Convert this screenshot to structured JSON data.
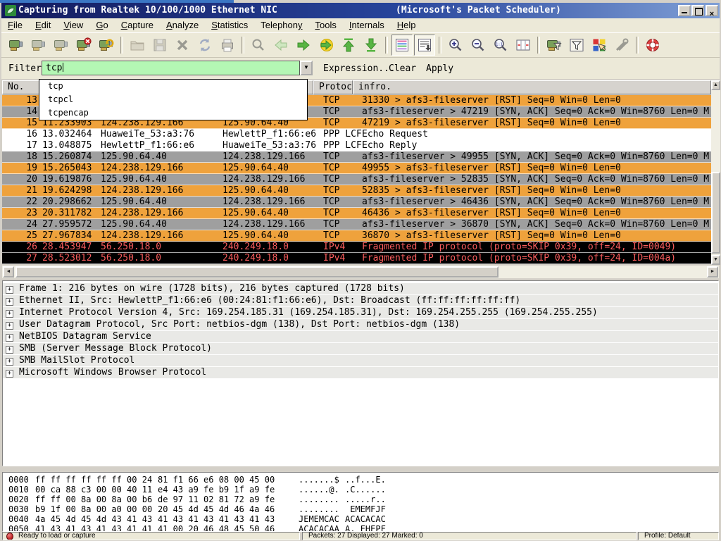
{
  "window": {
    "title_left": "Capturing from Realtek 10/100/1000 Ethernet NIC",
    "title_right": "(Microsoft's Packet Scheduler)"
  },
  "menu": {
    "items": [
      {
        "label": "File",
        "u": 0
      },
      {
        "label": "Edit",
        "u": 0
      },
      {
        "label": "View",
        "u": 0
      },
      {
        "label": "Go",
        "u": 0
      },
      {
        "label": "Capture",
        "u": 0
      },
      {
        "label": "Analyze",
        "u": 0
      },
      {
        "label": "Statistics",
        "u": 0
      },
      {
        "label": "Telephony",
        "u": 8
      },
      {
        "label": "Tools",
        "u": 0
      },
      {
        "label": "Internals",
        "u": 0
      },
      {
        "label": "Help",
        "u": 0
      }
    ]
  },
  "toolbar": {
    "buttons": [
      {
        "icon": "interfaces-icon"
      },
      {
        "icon": "capture-options-icon"
      },
      {
        "icon": "capture-start-icon"
      },
      {
        "icon": "capture-stop-icon"
      },
      {
        "icon": "capture-restart-icon"
      },
      {
        "sep": true
      },
      {
        "icon": "open-file-icon"
      },
      {
        "icon": "save-file-icon"
      },
      {
        "icon": "close-file-icon"
      },
      {
        "icon": "reload-icon"
      },
      {
        "icon": "print-icon"
      },
      {
        "sep": true
      },
      {
        "icon": "find-icon"
      },
      {
        "icon": "go-back-icon"
      },
      {
        "icon": "go-forward-icon"
      },
      {
        "icon": "goto-packet-icon"
      },
      {
        "icon": "goto-top-icon"
      },
      {
        "icon": "goto-bottom-icon"
      },
      {
        "sep": true
      },
      {
        "icon": "colorize-icon",
        "pressed": true
      },
      {
        "icon": "autoscroll-icon",
        "pressed": true
      },
      {
        "sep": true
      },
      {
        "icon": "zoom-in-icon"
      },
      {
        "icon": "zoom-out-icon"
      },
      {
        "icon": "zoom-100-icon"
      },
      {
        "icon": "resize-columns-icon"
      },
      {
        "sep": true
      },
      {
        "icon": "capture-filter-icon"
      },
      {
        "icon": "display-filter-icon"
      },
      {
        "icon": "coloring-rules-icon"
      },
      {
        "icon": "preferences-icon"
      },
      {
        "sep": true
      },
      {
        "icon": "help-icon"
      }
    ]
  },
  "filter_bar": {
    "label": "Filter:",
    "value": "tcp",
    "expression_label": "Expression...",
    "clear_label": "Clear",
    "apply_label": "Apply",
    "autocomplete": [
      "tcp",
      "tcpcl",
      "tcpencap"
    ]
  },
  "packet_list": {
    "columns": {
      "no": "No.",
      "protocol": "Protocol",
      "info": "infro."
    },
    "rows": [
      {
        "no": "13",
        "time": "",
        "source": "",
        "destination": "",
        "protocol": "TCP",
        "info": "31330 > afs3-fileserver [RST] Seq=0 Win=0 Len=0",
        "style": "orange"
      },
      {
        "no": "14",
        "time": "",
        "source": "",
        "destination": "",
        "protocol": "TCP",
        "info": "afs3-fileserver > 47219 [SYN, ACK] Seq=0 Ack=0 Win=8760 Len=0 M",
        "style": "gray"
      },
      {
        "no": "15",
        "time": "11.233903",
        "source": "124.238.129.166",
        "destination": "125.90.64.40",
        "protocol": "TCP",
        "info": "47219 > afs3-fileserver [RST] Seq=0 Win=0 Len=0",
        "style": "orange"
      },
      {
        "no": "16",
        "time": "13.032464",
        "source": "HuaweiTe_53:a3:76",
        "destination": "HewlettP_f1:66:e6",
        "protocol": "PPP LCF",
        "info": "Echo Request",
        "style": "white"
      },
      {
        "no": "17",
        "time": "13.048875",
        "source": "HewlettP_f1:66:e6",
        "destination": "HuaweiTe_53:a3:76",
        "protocol": "PPP LCF",
        "info": "Echo Reply",
        "style": "white"
      },
      {
        "no": "18",
        "time": "15.260874",
        "source": "125.90.64.40",
        "destination": "124.238.129.166",
        "protocol": "TCP",
        "info": "afs3-fileserver > 49955 [SYN, ACK] Seq=0 Ack=0 Win=8760 Len=0 M",
        "style": "gray"
      },
      {
        "no": "19",
        "time": "15.265043",
        "source": "124.238.129.166",
        "destination": "125.90.64.40",
        "protocol": "TCP",
        "info": "49955 > afs3-fileserver [RST] Seq=0 Win=0 Len=0",
        "style": "orange"
      },
      {
        "no": "20",
        "time": "19.619876",
        "source": "125.90.64.40",
        "destination": "124.238.129.166",
        "protocol": "TCP",
        "info": "afs3-fileserver > 52835 [SYN, ACK] Seq=0 Ack=0 Win=8760 Len=0 M",
        "style": "gray"
      },
      {
        "no": "21",
        "time": "19.624298",
        "source": "124.238.129.166",
        "destination": "125.90.64.40",
        "protocol": "TCP",
        "info": "52835 > afs3-fileserver [RST] Seq=0 Win=0 Len=0",
        "style": "orange"
      },
      {
        "no": "22",
        "time": "20.298662",
        "source": "125.90.64.40",
        "destination": "124.238.129.166",
        "protocol": "TCP",
        "info": "afs3-fileserver > 46436 [SYN, ACK] Seq=0 Ack=0 Win=8760 Len=0 M",
        "style": "gray"
      },
      {
        "no": "23",
        "time": "20.311782",
        "source": "124.238.129.166",
        "destination": "125.90.64.40",
        "protocol": "TCP",
        "info": "46436 > afs3-fileserver [RST] Seq=0 Win=0 Len=0",
        "style": "orange"
      },
      {
        "no": "24",
        "time": "27.959572",
        "source": "125.90.64.40",
        "destination": "124.238.129.166",
        "protocol": "TCP",
        "info": "afs3-fileserver > 36870 [SYN, ACK] Seq=0 Ack=0 Win=8760 Len=0 M",
        "style": "gray"
      },
      {
        "no": "25",
        "time": "27.967834",
        "source": "124.238.129.166",
        "destination": "125.90.64.40",
        "protocol": "TCP",
        "info": "36870 > afs3-fileserver [RST] Seq=0 Win=0 Len=0",
        "style": "orange"
      },
      {
        "no": "26",
        "time": "28.453947",
        "source": "56.250.18.0",
        "destination": "240.249.18.0",
        "protocol": "IPv4",
        "info": "Fragmented IP protocol (proto=SKIP 0x39, off=24, ID=0049)",
        "style": "black"
      },
      {
        "no": "27",
        "time": "28.523012",
        "source": "56.250.18.0",
        "destination": "240.249.18.0",
        "protocol": "IPv4",
        "info": "Fragmented IP protocol (proto=SKIP 0x39, off=24, ID=004a)",
        "style": "black"
      }
    ]
  },
  "details": {
    "lines": [
      "Frame 1: 216 bytes on wire (1728 bits), 216 bytes captured (1728 bits)",
      "Ethernet II, Src: HewlettP_f1:66:e6 (00:24:81:f1:66:e6), Dst: Broadcast (ff:ff:ff:ff:ff:ff)",
      "Internet Protocol Version 4, Src: 169.254.185.31 (169.254.185.31), Dst: 169.254.255.255 (169.254.255.255)",
      "User Datagram Protocol, Src Port: netbios-dgm (138), Dst Port: netbios-dgm (138)",
      "NetBIOS Datagram Service",
      "SMB (Server Message Block Protocol)",
      "SMB MailSlot Protocol",
      "Microsoft Windows Browser Protocol"
    ]
  },
  "hex": {
    "rows": [
      {
        "offset": "0000",
        "hex1": "ff ff ff ff ff ff 00 24",
        "hex2": "81 f1 66 e6 08 00 45 00",
        "ascii1": ".......$",
        "ascii2": "..f...E."
      },
      {
        "offset": "0010",
        "hex1": "00 ca 88 c3 00 00 40 11",
        "hex2": "e4 43 a9 fe b9 1f a9 fe",
        "ascii1": "......@.",
        "ascii2": ".C......"
      },
      {
        "offset": "0020",
        "hex1": "ff ff 00 8a 00 8a 00 b6",
        "hex2": "de 97 11 02 81 72 a9 fe",
        "ascii1": "........",
        "ascii2": ".....r.."
      },
      {
        "offset": "0030",
        "hex1": "b9 1f 00 8a 00 a0 00 00",
        "hex2": "20 45 4d 45 4d 46 4a 46",
        "ascii1": "........",
        "ascii2": " EMEMFJF"
      },
      {
        "offset": "0040",
        "hex1": "4a 45 4d 45 4d 43 41 43",
        "hex2": "41 43 41 43 41 43 41 43",
        "ascii1": "JEMEMCAC",
        "ascii2": "ACACACAC"
      },
      {
        "offset": "0050",
        "hex1": "41 43 41 43 41 43 41 41",
        "hex2": "41 00 20 46 48 45 50 46",
        "ascii1": "ACACACAA",
        "ascii2": "A. FHEPF"
      }
    ]
  },
  "status_bar": {
    "ready_text": "Ready to load or capture",
    "packets_text": "Packets: 27 Displayed: 27 Marked: 0",
    "profile_text": "Profile: Default"
  },
  "colors": {
    "titlebar_left": "#131a5e",
    "titlebar_right": "#7f9fd6",
    "row_orange": "#efa23c",
    "row_gray": "#9f9f9f",
    "row_black_bg": "#000000",
    "row_black_text": "#fc5e5e",
    "filter_valid_bg": "#b4f7b4",
    "detail_stripe": "#e9e9e6"
  }
}
